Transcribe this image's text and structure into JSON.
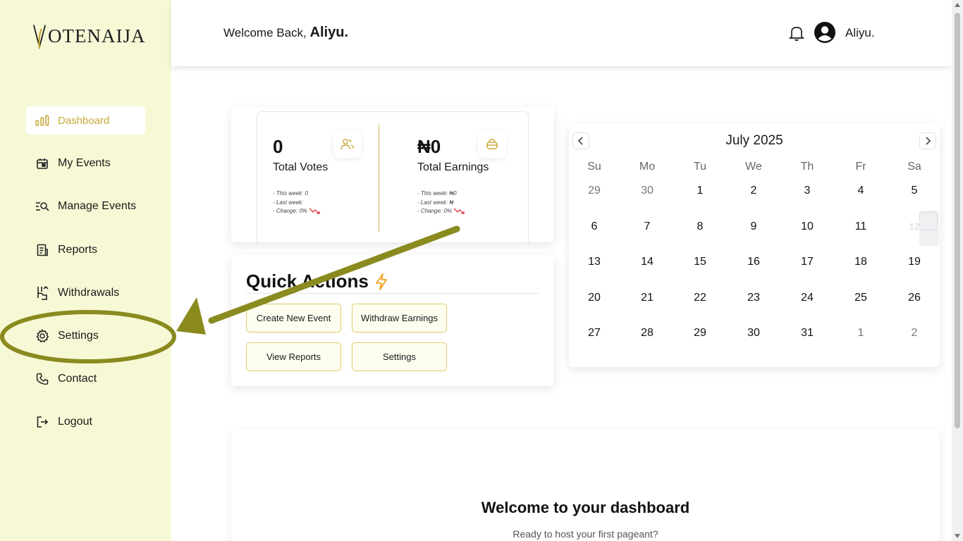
{
  "brand": {
    "logo_text": "OTENAIJA",
    "logo_letter": "V"
  },
  "sidebar": {
    "items": [
      {
        "label": "Dashboard",
        "icon": "bar-chart-icon",
        "active": true
      },
      {
        "label": "My Events",
        "icon": "calendar-icon"
      },
      {
        "label": "Manage Events",
        "icon": "list-search-icon"
      },
      {
        "label": "Reports",
        "icon": "report-icon"
      },
      {
        "label": "Withdrawals",
        "icon": "withdraw-icon"
      },
      {
        "label": "Settings",
        "icon": "gear-icon"
      },
      {
        "label": "Contact",
        "icon": "phone-icon"
      },
      {
        "label": "Logout",
        "icon": "logout-icon"
      }
    ]
  },
  "header": {
    "greeting": "Welcome Back,",
    "user_name": "Aliyu.",
    "user_label": "Aliyu."
  },
  "stats": {
    "votes": {
      "value": "0",
      "label": "Total Votes",
      "this_week": "- This week: 0",
      "last_week": "- Last week:",
      "change": "- Change: 0%"
    },
    "earnings": {
      "value": "₦0",
      "label": "Total Earnings",
      "this_week": "- This week: ₦0",
      "last_week": "- Last week: ₦",
      "change": "- Change: 0%"
    }
  },
  "quick_actions": {
    "title": "Quick Actions",
    "buttons": [
      "Create New Event",
      "Withdraw Earnings",
      "View Reports",
      "Settings"
    ]
  },
  "calendar": {
    "title": "July 2025",
    "weekdays": [
      "Su",
      "Mo",
      "Tu",
      "We",
      "Th",
      "Fr",
      "Sa"
    ],
    "weeks": [
      [
        "29",
        "30",
        "1",
        "2",
        "3",
        "4",
        "5"
      ],
      [
        "6",
        "7",
        "8",
        "9",
        "10",
        "11",
        "12"
      ],
      [
        "13",
        "14",
        "15",
        "16",
        "17",
        "18",
        "19"
      ],
      [
        "20",
        "21",
        "22",
        "23",
        "24",
        "25",
        "26"
      ],
      [
        "27",
        "28",
        "29",
        "30",
        "31",
        "1",
        "2"
      ]
    ]
  },
  "dashboard": {
    "title": "Welcome to your dashboard",
    "subtitle": "Ready to host your first pageant?"
  },
  "colors": {
    "sidebar_bg": "#f7f9d6",
    "accent_gold": "#c7a93a",
    "annotation": "#8a8a1f",
    "trend_down": "#e0303a"
  }
}
